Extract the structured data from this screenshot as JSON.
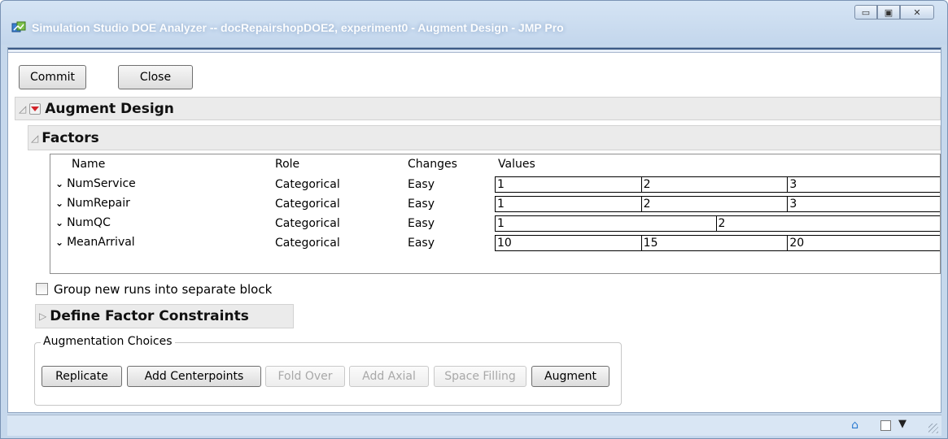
{
  "window": {
    "title": "Simulation Studio DOE Analyzer -- docRepairshopDOE2, experiment0 - Augment Design - JMP Pro",
    "icon": "jmp-app-icon",
    "controls": [
      "minimize-icon",
      "maximize-icon",
      "close-icon"
    ]
  },
  "toolbar": {
    "commit_label": "Commit",
    "close_label": "Close"
  },
  "augment_design": {
    "title": "Augment Design",
    "factors": {
      "title": "Factors",
      "columns": [
        "Name",
        "Role",
        "Changes",
        "Values"
      ],
      "rows": [
        {
          "name": "NumService",
          "role": "Categorical",
          "changes": "Easy",
          "values": [
            "1",
            "2",
            "3"
          ]
        },
        {
          "name": "NumRepair",
          "role": "Categorical",
          "changes": "Easy",
          "values": [
            "1",
            "2",
            "3"
          ]
        },
        {
          "name": "NumQC",
          "role": "Categorical",
          "changes": "Easy",
          "values": [
            "1",
            "2"
          ]
        },
        {
          "name": "MeanArrival",
          "role": "Categorical",
          "changes": "Easy",
          "values": [
            "10",
            "15",
            "20"
          ]
        }
      ]
    },
    "group_checkbox": {
      "label": "Group new runs into separate block",
      "checked": false
    },
    "constraints_title": "Define Factor Constraints",
    "augmentation": {
      "legend": "Augmentation Choices",
      "buttons": [
        {
          "label": "Replicate",
          "enabled": true
        },
        {
          "label": "Add Centerpoints",
          "enabled": true
        },
        {
          "label": "Fold Over",
          "enabled": false
        },
        {
          "label": "Add Axial",
          "enabled": false
        },
        {
          "label": "Space Filling",
          "enabled": false
        },
        {
          "label": "Augment",
          "enabled": true
        }
      ]
    }
  },
  "statusbar": {
    "icons": [
      "home-icon",
      "checkbox-icon",
      "dropdown-arrow-icon"
    ]
  }
}
